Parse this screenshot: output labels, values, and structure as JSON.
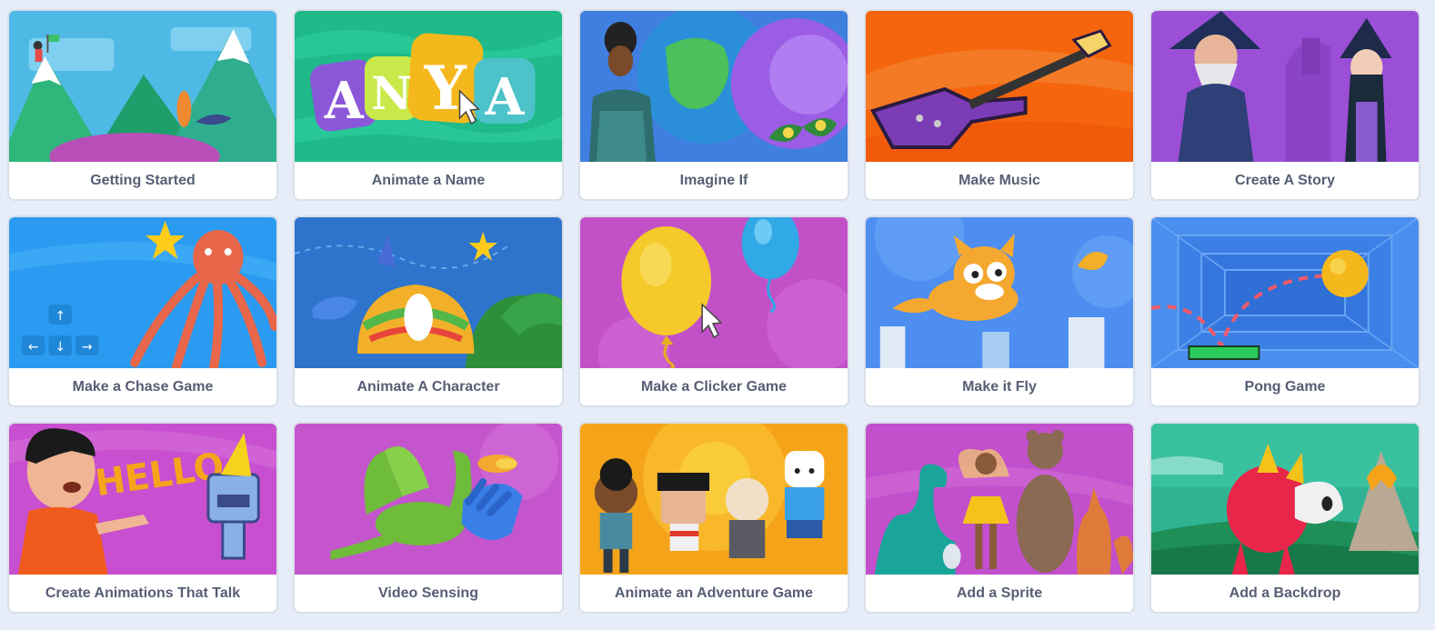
{
  "tutorials": [
    {
      "title": "Getting Started",
      "art": "getting-started-art"
    },
    {
      "title": "Animate a Name",
      "art": "animate-name-art",
      "letters": "ANYA"
    },
    {
      "title": "Imagine If",
      "art": "imagine-if-art"
    },
    {
      "title": "Make Music",
      "art": "make-music-art"
    },
    {
      "title": "Create A Story",
      "art": "create-story-art"
    },
    {
      "title": "Make a Chase Game",
      "art": "chase-game-art"
    },
    {
      "title": "Animate A Character",
      "art": "animate-character-art"
    },
    {
      "title": "Make a Clicker Game",
      "art": "clicker-game-art"
    },
    {
      "title": "Make it Fly",
      "art": "make-it-fly-art"
    },
    {
      "title": "Pong Game",
      "art": "pong-game-art"
    },
    {
      "title": "Create Animations That Talk",
      "art": "animations-talk-art",
      "letters": "HELLO"
    },
    {
      "title": "Video Sensing",
      "art": "video-sensing-art"
    },
    {
      "title": "Animate an Adventure Game",
      "art": "adventure-game-art"
    },
    {
      "title": "Add a Sprite",
      "art": "add-sprite-art"
    },
    {
      "title": "Add a Backdrop",
      "art": "add-backdrop-art"
    }
  ],
  "colors": {
    "page_bg": "#e6edf8",
    "label_text": "#575e75",
    "card_border": "#d9dfe8"
  }
}
